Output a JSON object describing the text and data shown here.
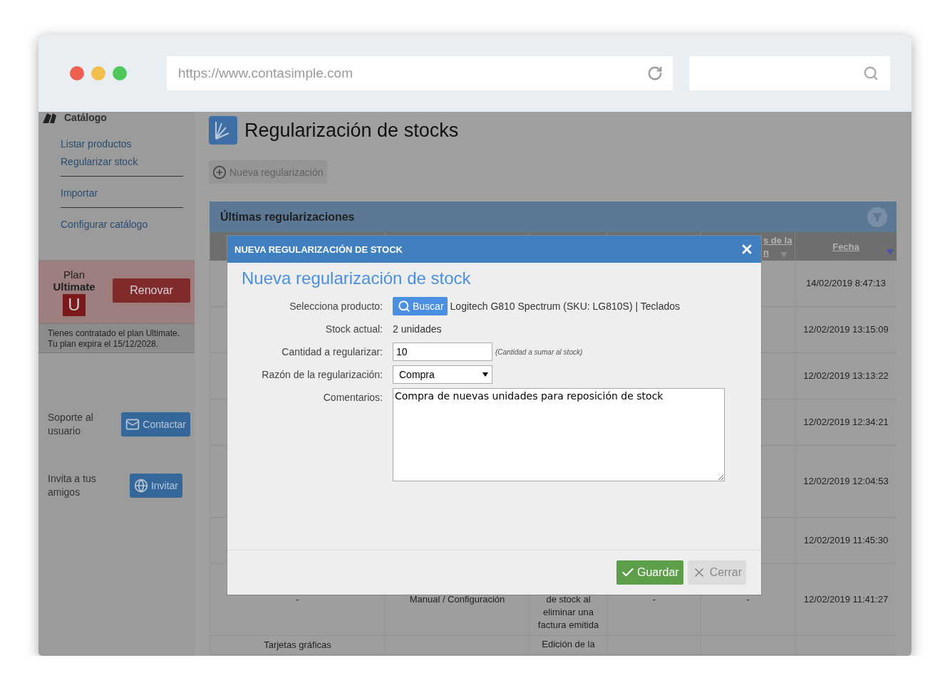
{
  "browser": {
    "url": "https://www.contasimple.com"
  },
  "sidebar": {
    "section": "Catálogo",
    "links": [
      {
        "kind": "link",
        "label": "Listar productos"
      },
      {
        "kind": "link",
        "label": "Regularizar stock"
      },
      {
        "kind": "divider"
      },
      {
        "kind": "link",
        "label": "Importar"
      },
      {
        "kind": "divider"
      },
      {
        "kind": "link",
        "label": "Configurar catálogo"
      }
    ],
    "plan": {
      "label": "Plan",
      "name": "Ultimate",
      "badge": "U",
      "button": "Renovar",
      "note": [
        "Tienes contratado el plan Ultimate.",
        "Tu plan expira el 15/12/2028."
      ]
    },
    "help": [
      {
        "kind": "mail",
        "text": "Soporte al usuario",
        "button": "Contactar"
      },
      {
        "kind": "globe",
        "text": "Invita a tus amigos",
        "button": "Invitar"
      }
    ]
  },
  "page": {
    "title": "Regularización de stocks",
    "new_button": "Nueva regularización",
    "panel": {
      "title": "Últimas regularizaciones",
      "columns": [
        {},
        {},
        {},
        {},
        {
          "label": "s de la n",
          "sorted": false
        },
        {
          "label": "Fecha",
          "sorted": true
        }
      ],
      "rows": [
        {
          "cells": [
            "",
            "",
            "",
            "",
            "",
            "14/02/2019 8:47:13"
          ]
        },
        {
          "cells": [
            "",
            "",
            "",
            "",
            "",
            "12/02/2019 13:15:09"
          ]
        },
        {
          "cells": [
            "",
            "",
            "",
            "",
            "",
            "12/02/2019 13:13:22"
          ]
        },
        {
          "cells": [
            "",
            "",
            "",
            "",
            "",
            "12/02/2019 12:34:21"
          ]
        },
        {
          "cells": [
            "",
            "",
            "",
            "",
            "",
            "12/02/2019 12:04:53"
          ]
        },
        {
          "cells": [
            "",
            "",
            "",
            "",
            "",
            "12/02/2019 11:45:30"
          ]
        },
        {
          "cells": [
            "-",
            "Manual / Configuración",
            "de stock al eliminar una factura emitida",
            "-",
            "-",
            "12/02/2019 11:41:27"
          ]
        },
        {
          "cells": [
            "Tarjetas gráficas",
            "",
            "Edición de la",
            "",
            "",
            ""
          ]
        }
      ]
    }
  },
  "modal": {
    "header": "NUEVA REGULARIZACIÓN DE STOCK",
    "title": "Nueva regularización de stock",
    "fields": [
      {
        "kind": "product",
        "label": "Selecciona producto:",
        "button": "Buscar",
        "value": "Logitech G810 Spectrum (SKU: LG810S) | Teclados"
      },
      {
        "kind": "text",
        "label": "Stock actual:",
        "value": "2 unidades"
      },
      {
        "kind": "input",
        "label": "Cantidad a regularizar:",
        "value": "10",
        "hint": "(Cantidad a sumar al stock)"
      },
      {
        "kind": "select",
        "label": "Razón de la regularización:",
        "value": "Compra"
      },
      {
        "kind": "textarea",
        "label": "Comentarios:",
        "value": "Compra de nuevas unidades para reposición de stock"
      }
    ],
    "save": "Guardar",
    "close": "Cerrar"
  }
}
